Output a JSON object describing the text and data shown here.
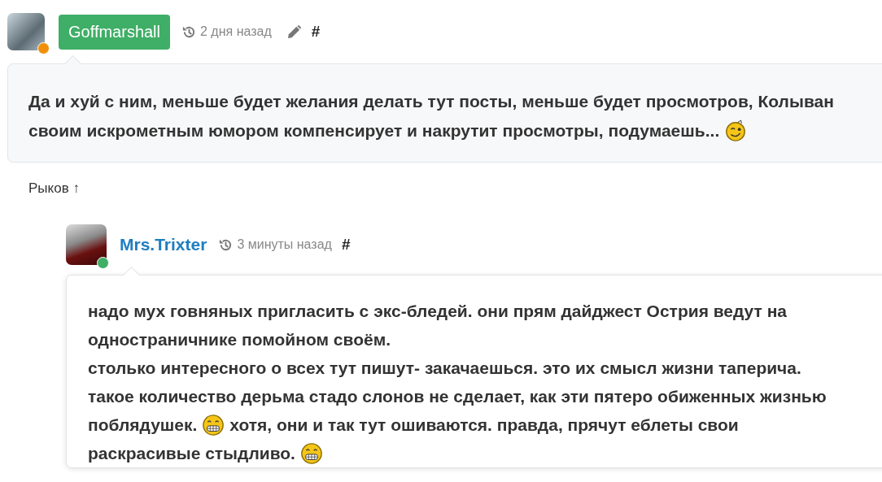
{
  "comments": [
    {
      "author": "Goffmarshall",
      "kind": "badge",
      "color": "#f0900a",
      "time": "2 дня назад",
      "editable": true,
      "anchor": "#",
      "lines": [
        [
          {
            "kind": "text",
            "text": "Да и хуй с ним, меньше будет желания делать тут посты, меньше будет просмотров, Колыван"
          }
        ],
        [
          {
            "kind": "text",
            "text": "своим искрометным юмором компенсирует и накрутит просмотры, подумаешь..."
          },
          {
            "kind": "wink"
          }
        ]
      ],
      "parent_link": "Рыков ↑",
      "children": [
        {
          "author": "Mrs.Trixter",
          "kind": "link",
          "color": "#3fae66",
          "time": "3 минуты назад",
          "editable": false,
          "anchor": "#",
          "lines": [
            [
              {
                "kind": "text",
                "text": "надо мух говняных пригласить с экс-бледей. они прям дайджест Острия ведут на"
              }
            ],
            [
              {
                "kind": "text",
                "text": "одностраничнике помойном своём."
              }
            ],
            [
              {
                "kind": "text",
                "text": "столько интересного о всех тут пишут- закачаешься. это их смысл жизни таперича."
              }
            ],
            [
              {
                "kind": "text",
                "text": "такое количество дерьма стадо слонов не сделает, как эти пятеро обиженных жизнью"
              }
            ],
            [
              {
                "kind": "text",
                "text": "поблядушек."
              },
              {
                "kind": "grin"
              },
              {
                "kind": "text",
                "text": "хотя, они и так тут ошиваются. правда, прячут еблеты свои"
              }
            ],
            [
              {
                "kind": "text",
                "text": "раскрасивые стыдливо."
              },
              {
                "kind": "grin"
              }
            ]
          ]
        }
      ]
    }
  ]
}
